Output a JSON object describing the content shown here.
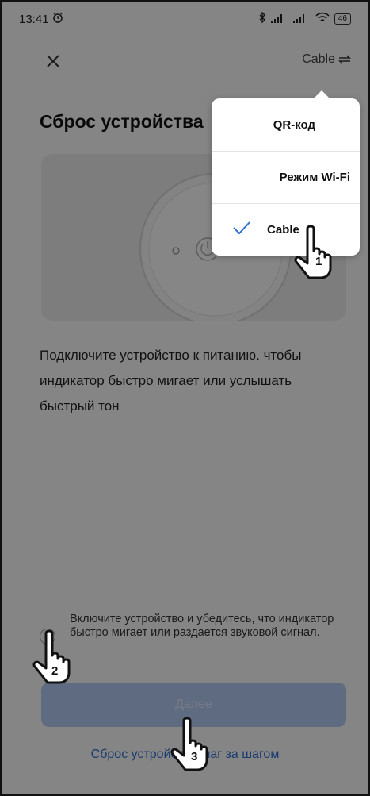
{
  "status_bar": {
    "time": "13:41",
    "battery": "46"
  },
  "header": {
    "mode_label": "Cable"
  },
  "page": {
    "title": "Сброс устройства",
    "description": "Подключите устройство к питанию. чтобы индикатор быстро мигает или услышать быстрый тон",
    "confirm_text": "Включите устройство и убедитесь, что индикатор быстро мигает или раздается звуковой сигнал.",
    "next_button": "Далее",
    "reset_link": "Сброс устройства шаг за шагом"
  },
  "mode_menu": {
    "items": [
      {
        "label": "QR-код",
        "selected": false
      },
      {
        "label": "Режим Wi-Fi",
        "selected": false
      },
      {
        "label": "Cable",
        "selected": true
      }
    ]
  },
  "annotations": {
    "step1": "1",
    "step2": "2",
    "step3": "3"
  },
  "colors": {
    "accent": "#2f6fd0",
    "button_disabled": "#aec6ee",
    "overlay": "rgba(0,0,0,0.46)"
  }
}
